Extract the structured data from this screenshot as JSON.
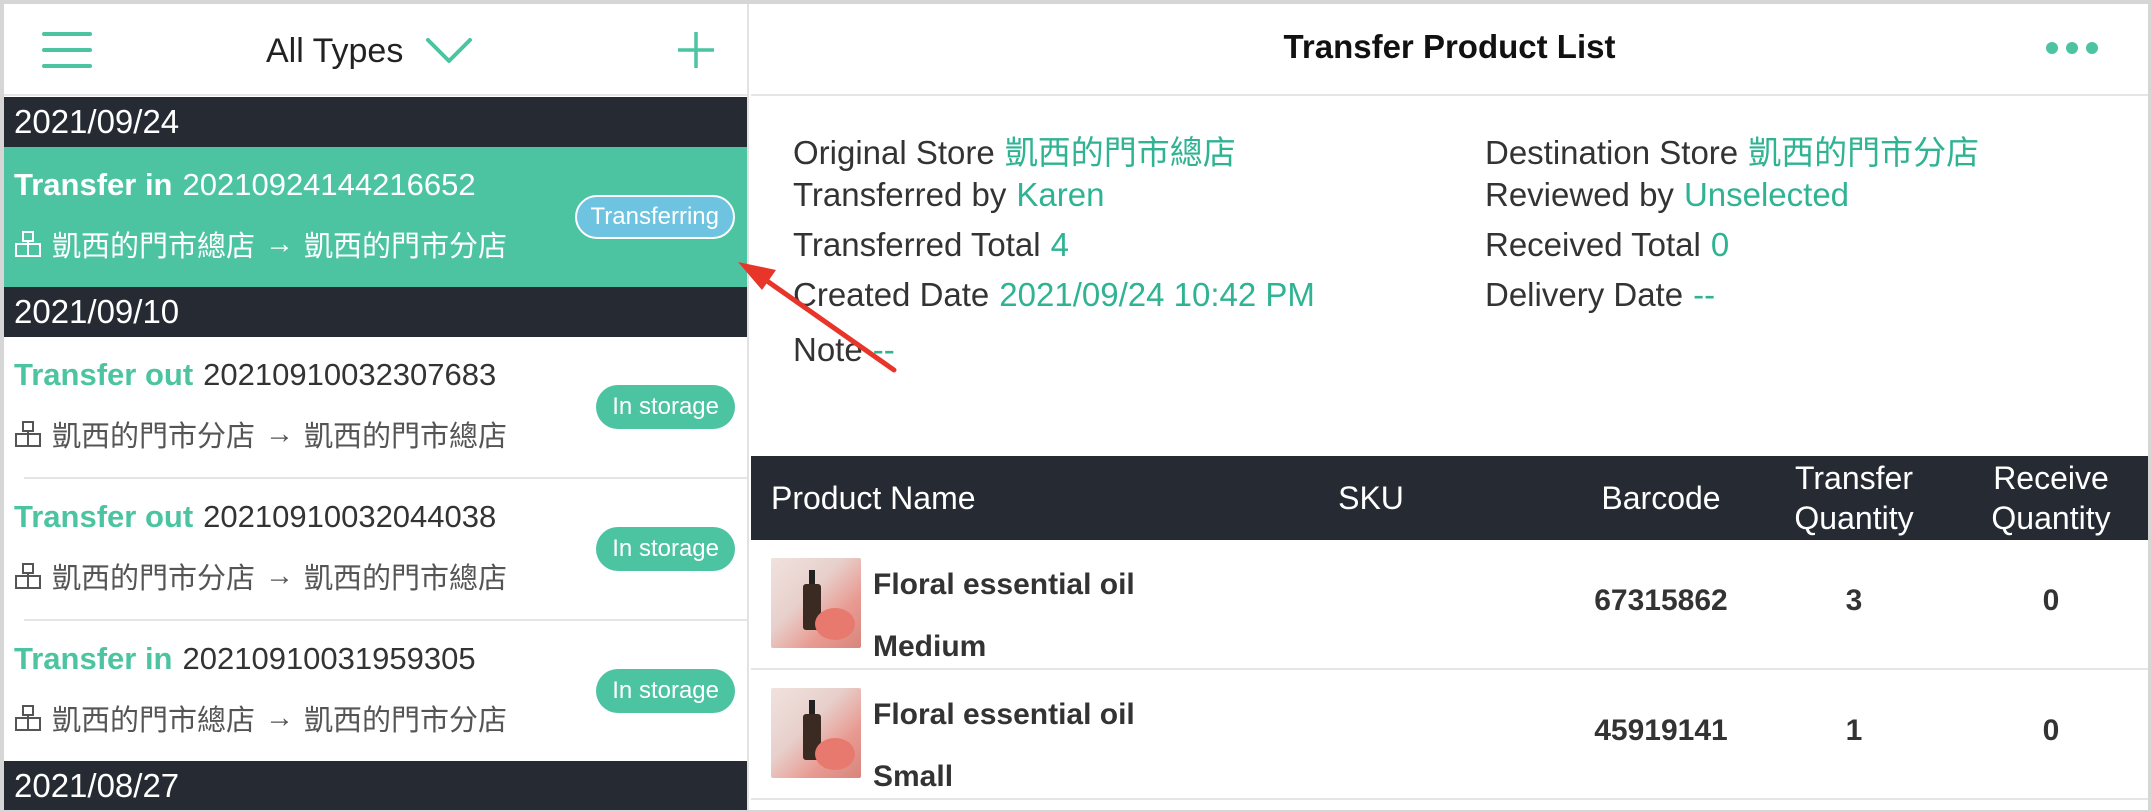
{
  "left": {
    "filter_label": "All Types",
    "groups": [
      {
        "date": "2021/09/24"
      },
      {
        "date": "2021/09/10"
      },
      {
        "date": "2021/08/27"
      }
    ],
    "transfers": [
      {
        "kind": "Transfer in",
        "number": "20210924144216652",
        "from": "凱西的門市總店",
        "to": "凱西的門市分店",
        "status": "Transferring"
      },
      {
        "kind": "Transfer out",
        "number": "20210910032307683",
        "from": "凱西的門市分店",
        "to": "凱西的門市總店",
        "status": "In storage"
      },
      {
        "kind": "Transfer out",
        "number": "20210910032044038",
        "from": "凱西的門市分店",
        "to": "凱西的門市總店",
        "status": "In storage"
      },
      {
        "kind": "Transfer in",
        "number": "20210910031959305",
        "from": "凱西的門市總店",
        "to": "凱西的門市分店",
        "status": "In storage"
      }
    ],
    "arrow_glyph": "→"
  },
  "right": {
    "title": "Transfer Product List",
    "info": {
      "original_store_label": "Original Store",
      "original_store": "凱西的門市總店",
      "destination_store_label": "Destination Store",
      "destination_store": "凱西的門市分店",
      "transferred_by_label": "Transferred by",
      "transferred_by": "Karen",
      "reviewed_by_label": "Reviewed by",
      "reviewed_by": "Unselected",
      "transferred_total_label": "Transferred Total",
      "transferred_total": "4",
      "received_total_label": "Received Total",
      "received_total": "0",
      "created_date_label": "Created Date",
      "created_date": "2021/09/24 10:42 PM",
      "delivery_date_label": "Delivery Date",
      "delivery_date": "--",
      "note_label": "Note",
      "note": "--"
    },
    "table": {
      "headers": {
        "product_name": "Product Name",
        "sku": "SKU",
        "barcode": "Barcode",
        "transfer_qty_1": "Transfer",
        "transfer_qty_2": "Quantity",
        "receive_qty_1": "Receive",
        "receive_qty_2": "Quantity"
      },
      "rows": [
        {
          "name": "Floral essential oil",
          "variant": "Medium",
          "sku": "",
          "barcode": "67315862",
          "transfer_qty": "3",
          "receive_qty": "0"
        },
        {
          "name": "Floral essential oil",
          "variant": "Small",
          "sku": "",
          "barcode": "45919141",
          "transfer_qty": "1",
          "receive_qty": "0"
        }
      ]
    }
  },
  "colors": {
    "accent": "#4cc4a1",
    "header_dark": "#262b33",
    "value_teal": "#2fb393",
    "badge_transferring": "#6ec3e0",
    "annotation_arrow": "#e8352a"
  }
}
